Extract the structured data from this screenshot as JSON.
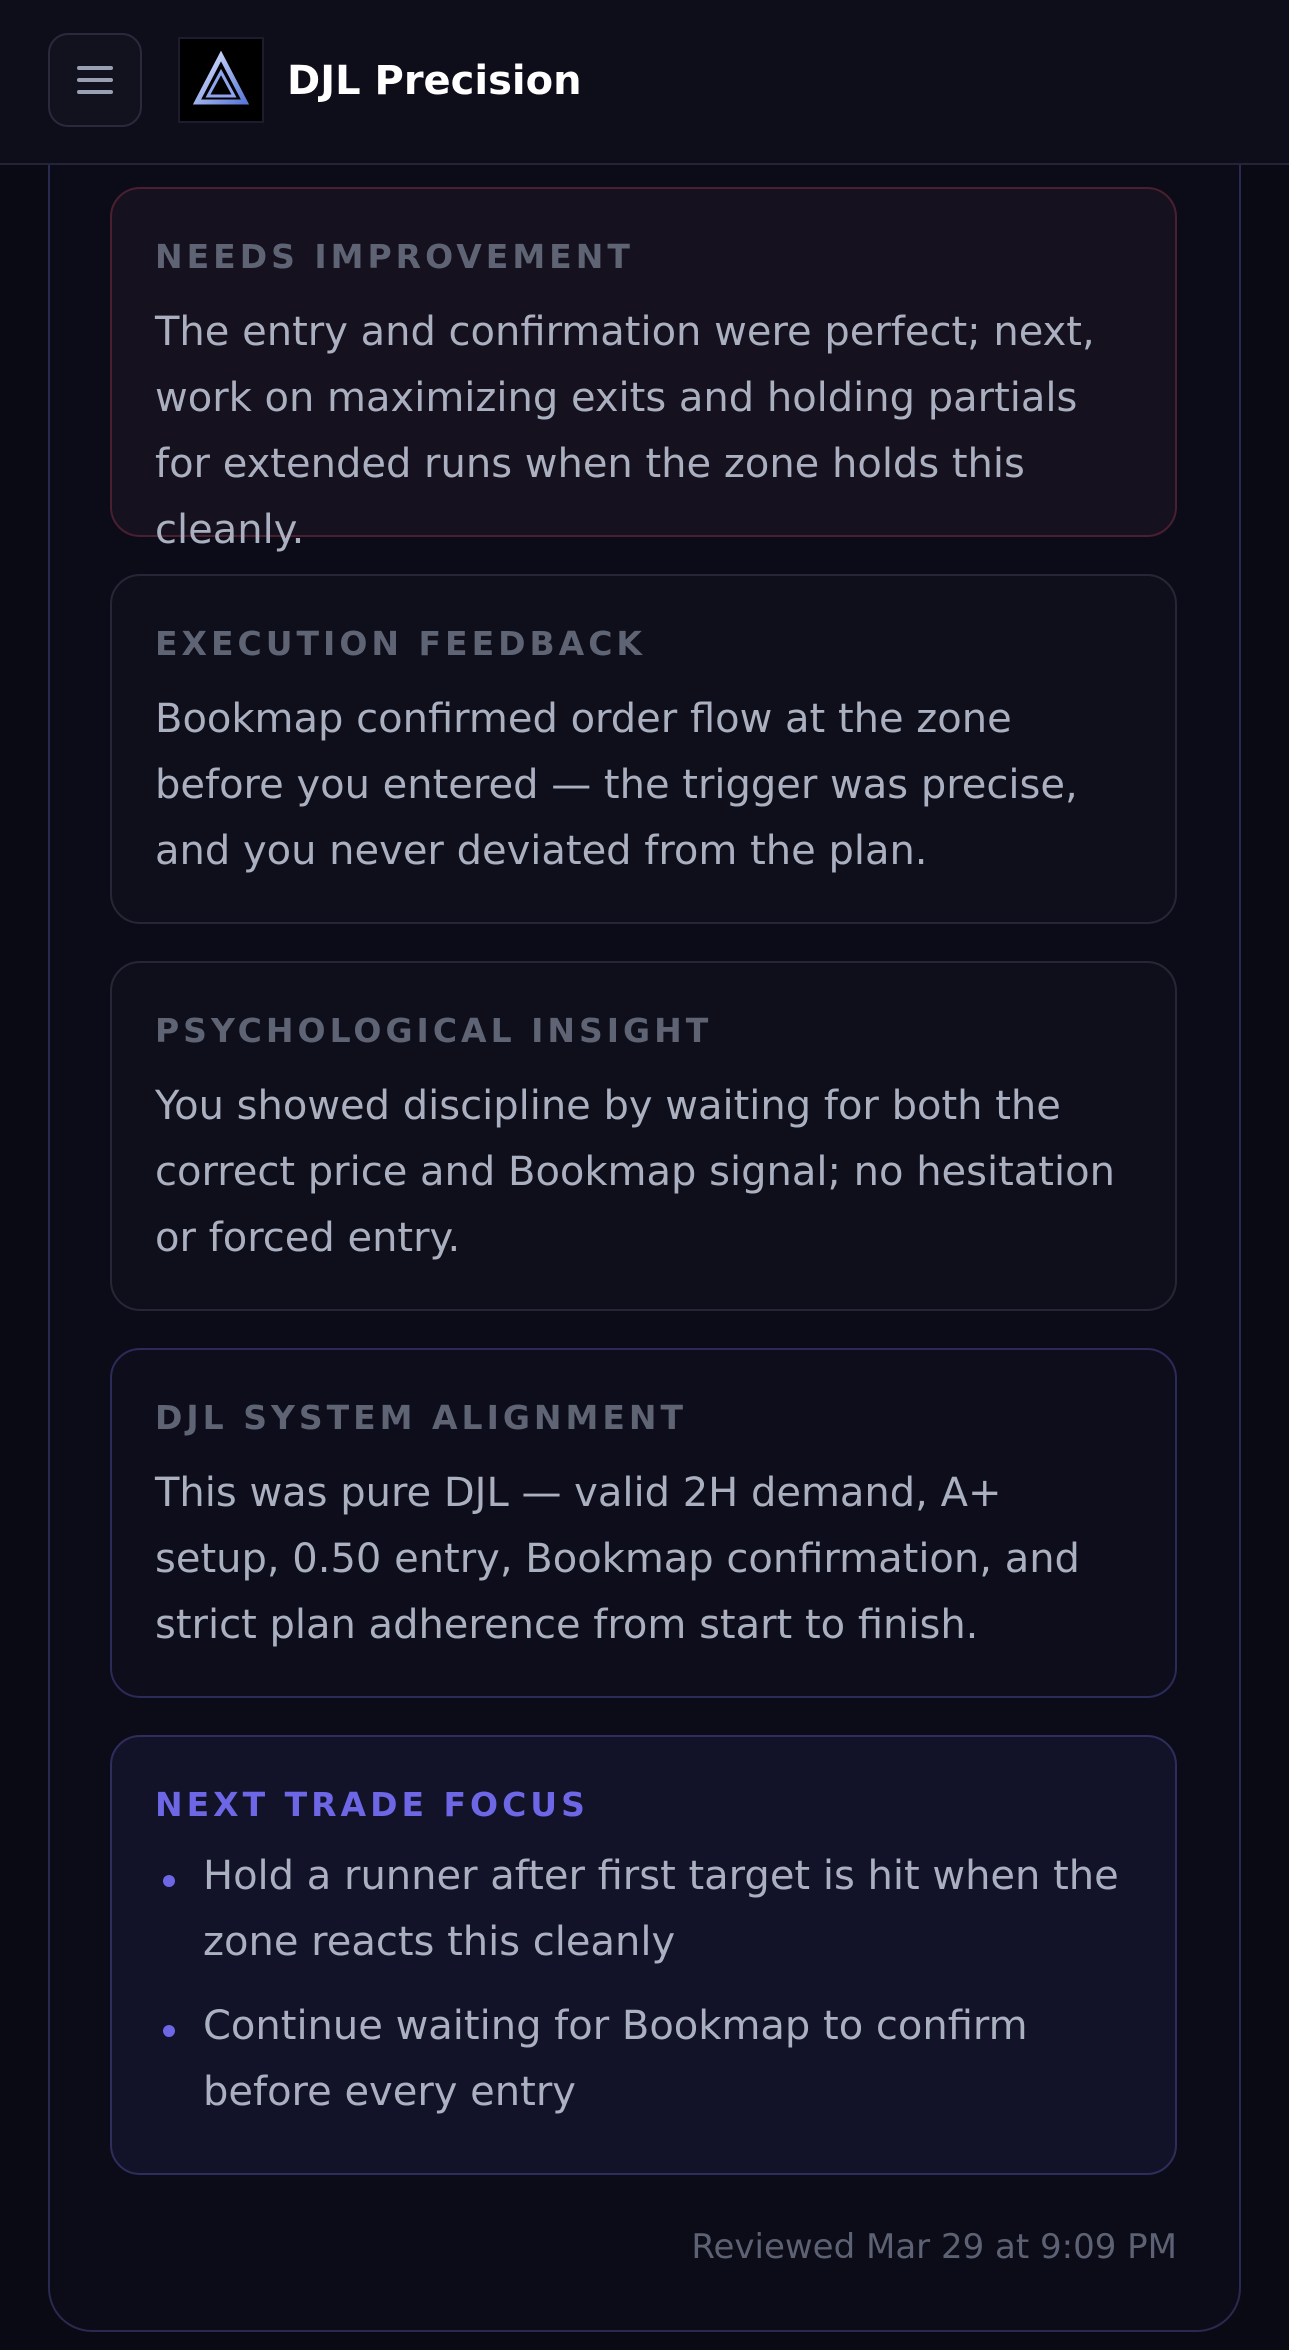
{
  "header": {
    "brand": "DJL Precision",
    "menu_icon": "hamburger-menu-icon",
    "logo_icon": "triangle-logo-icon"
  },
  "cards": {
    "needs_improvement": {
      "title": "NEEDS IMPROVEMENT",
      "text": "The entry and confirmation were perfect; next, work on maximizing exits and holding partials for extended runs when the zone holds this cleanly."
    },
    "execution_feedback": {
      "title": "EXECUTION FEEDBACK",
      "text": "Bookmap confirmed order flow at the zone before you entered — the trigger was precise, and you never deviated from the plan."
    },
    "psychological_insight": {
      "title": "PSYCHOLOGICAL INSIGHT",
      "text": "You showed discipline by waiting for both the correct price and Bookmap signal; no hesitation or forced entry."
    },
    "system_alignment": {
      "title": "DJL SYSTEM ALIGNMENT",
      "text": "This was pure DJL — valid 2H demand, A+ setup, 0.50 entry, Bookmap confirmation, and strict plan adherence from start to finish."
    },
    "next_trade_focus": {
      "title": "NEXT TRADE FOCUS",
      "items": [
        "Hold a runner after first target is hit when the zone reacts this cleanly",
        "Continue waiting for Bookmap to confirm before every entry"
      ]
    }
  },
  "footer": {
    "reviewed": "Reviewed Mar 29 at 9:09 PM"
  },
  "colors": {
    "background": "#0a0a14",
    "accent": "#6d67e6",
    "improvement_border": "#4a1f30"
  }
}
